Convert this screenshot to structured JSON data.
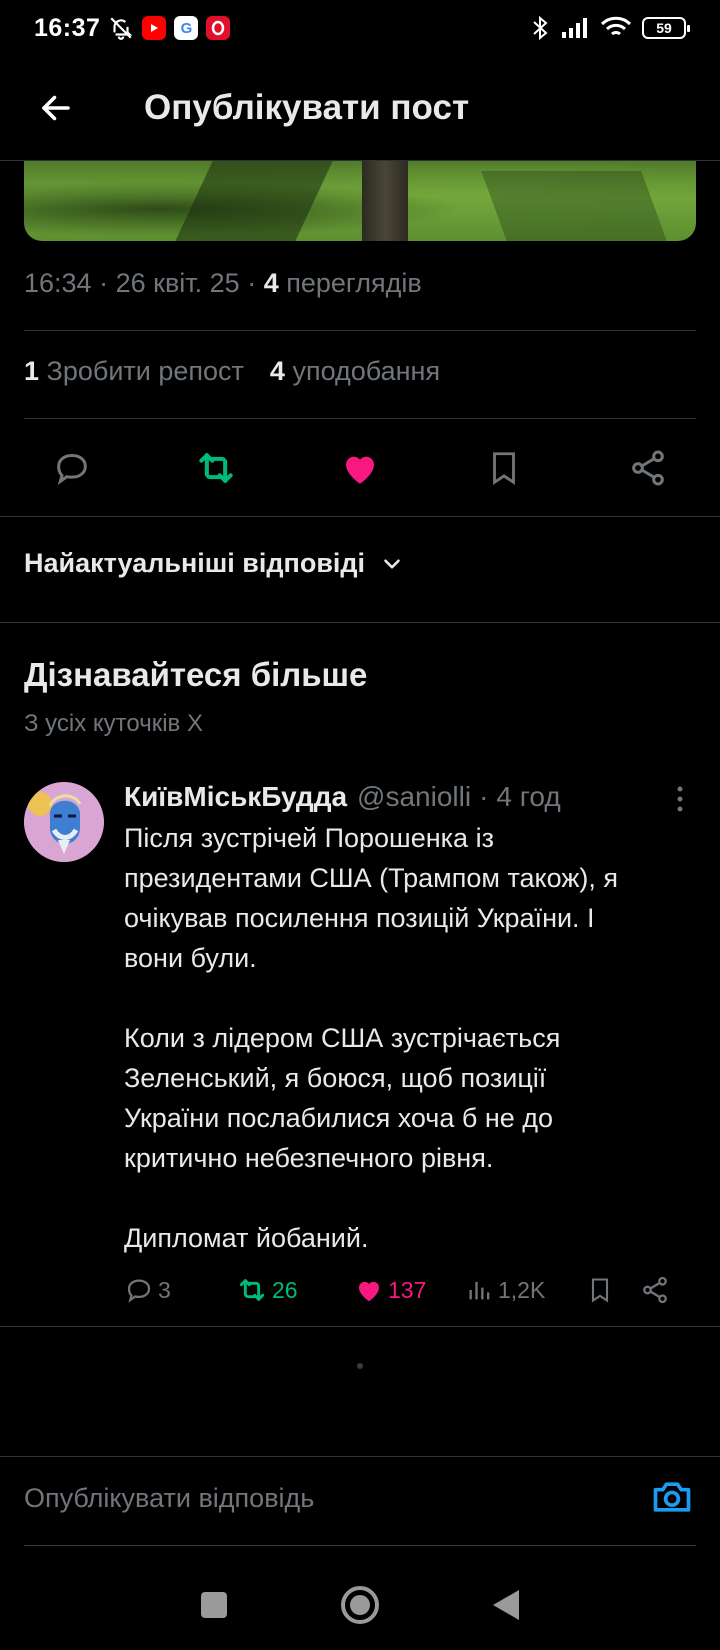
{
  "status_bar": {
    "time": "16:37",
    "battery": "59",
    "apps": [
      "youtube-icon",
      "google-icon",
      "opera-icon"
    ]
  },
  "header": {
    "title": "Опублікувати пост"
  },
  "post": {
    "time": "16:34",
    "date": "26 квіт. 25",
    "views_count": "4",
    "views_label": "переглядів",
    "reposts_count": "1",
    "reposts_label": "Зробити репост",
    "likes_count": "4",
    "likes_label": "уподобання",
    "liked": true,
    "reposted": true
  },
  "replies": {
    "sort_label": "Найактуальніші відповіді"
  },
  "discover": {
    "title": "Дізнавайтеся більше",
    "subtitle": "З усіх куточків X"
  },
  "tweet": {
    "name": "КиївМіськБудда",
    "handle": "@saniolli",
    "time": "4 год",
    "text": "Після зустрічей Порошенка із\nпрезидентами США (Трампом також), я\nочікував посилення позицій України. І\nвони були.\n\nКоли з лідером США зустрічається\nЗеленський, я боюся, щоб позиції\nУкраїни послабилися хоча б не до\nкритично небезпечного рівня.\n\nДипломат йобаний.",
    "replies": "3",
    "reposts": "26",
    "likes": "137",
    "views": "1,2K"
  },
  "reply_bar": {
    "placeholder": "Опублікувати відповідь"
  },
  "colors": {
    "background": "#000000",
    "text": "#e7e9ea",
    "muted": "#71767b",
    "divider": "#2f3336",
    "repost_green": "#00ba7c",
    "like_pink": "#f91880",
    "accent_blue": "#1d9bf0"
  }
}
